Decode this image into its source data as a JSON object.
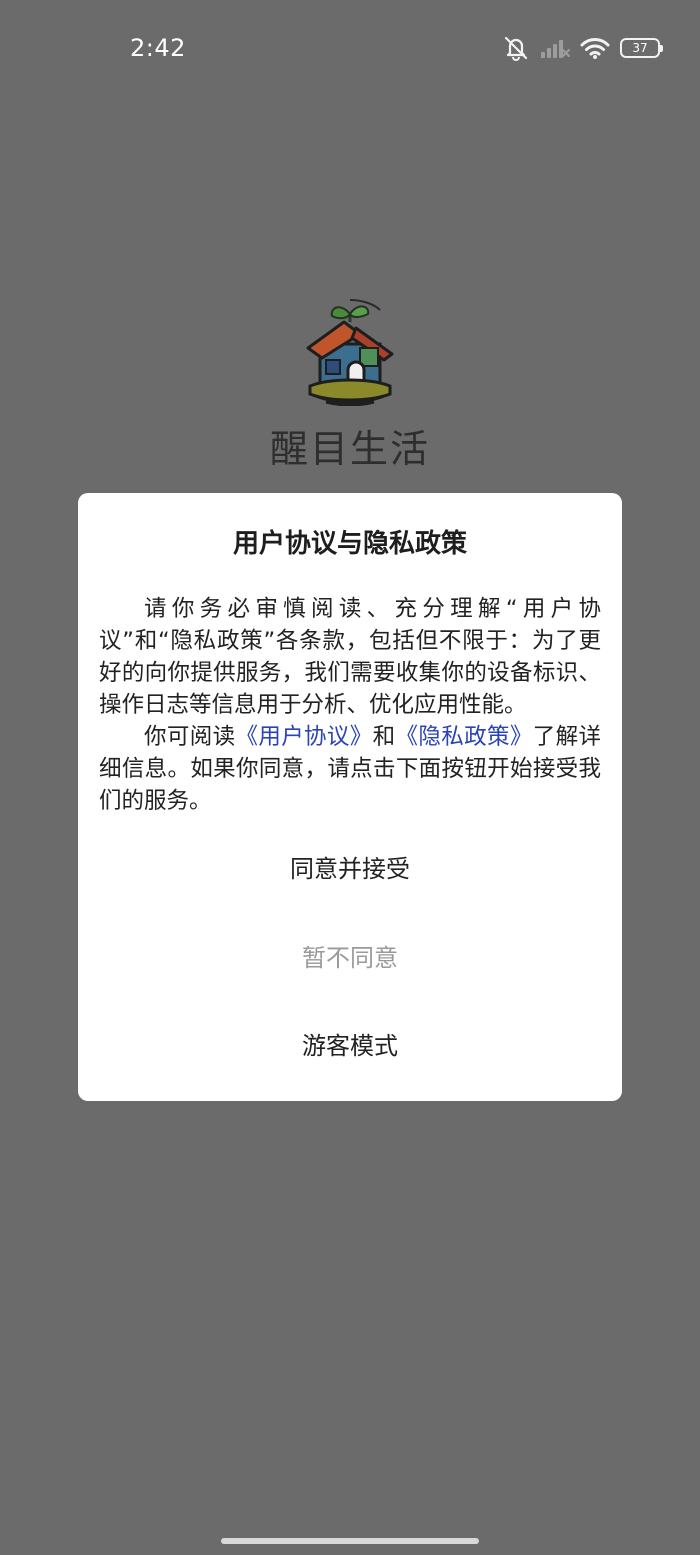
{
  "status_bar": {
    "time": "2:42",
    "battery_level": "37",
    "icons": [
      "mute-icon",
      "signal-icon",
      "wifi-icon",
      "battery-icon"
    ]
  },
  "app": {
    "name": "醒目生活",
    "logo": "house-sprout-logo"
  },
  "dialog": {
    "title": "用户协议与隐私政策",
    "paragraph1": "请你务必审慎阅读、充分理解“用户协议”和“隐私政策”各条款，包括但不限于：为了更好的向你提供服务，我们需要收集你的设备标识、操作日志等信息用于分析、优化应用性能。",
    "paragraph2_prefix": "你可阅读",
    "user_agreement_link": "《用户协议》",
    "paragraph2_and": "和",
    "privacy_policy_link": "《隐私政策》",
    "paragraph2_suffix": "了解详细信息。如果你同意，请点击下面按钮开始接受我们的服务。",
    "accept_button": "同意并接受",
    "decline_button": "暂不同意",
    "guest_button": "游客模式"
  },
  "colors": {
    "overlay": "#6b6b6b",
    "dialog_bg": "#ffffff",
    "link": "#2a44b8",
    "decline_text": "#9a9a9a"
  }
}
